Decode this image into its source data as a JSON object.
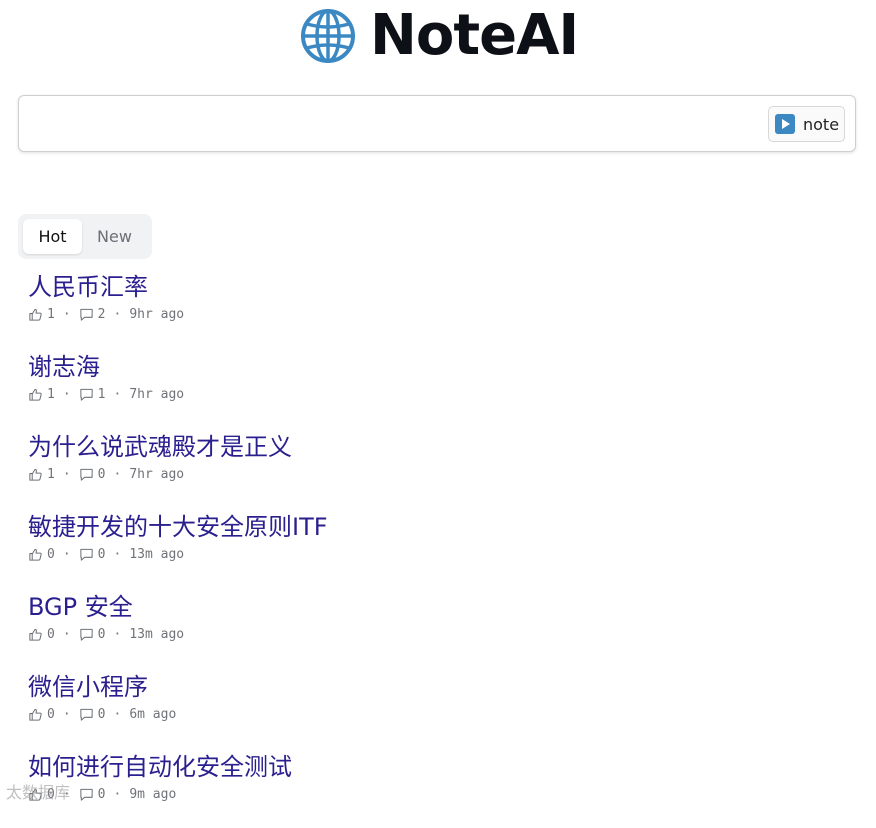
{
  "app": {
    "title": "NoteAI",
    "logo_icon": "globe-icon"
  },
  "prompt": {
    "value": "",
    "placeholder": "",
    "button_label": "note",
    "button_icon": "play-icon"
  },
  "tabs": [
    {
      "label": "Hot",
      "active": true
    },
    {
      "label": "New",
      "active": false
    }
  ],
  "posts": [
    {
      "title": "人民币汇率",
      "likes": "1",
      "comments": "2",
      "time": "9hr ago"
    },
    {
      "title": "谢志海",
      "likes": "1",
      "comments": "1",
      "time": "7hr ago"
    },
    {
      "title": "为什么说武魂殿才是正义",
      "likes": "1",
      "comments": "0",
      "time": "7hr ago"
    },
    {
      "title": "敏捷开发的十大安全原则ITF",
      "likes": "0",
      "comments": "0",
      "time": "13m ago"
    },
    {
      "title": "BGP 安全",
      "likes": "0",
      "comments": "0",
      "time": "13m ago"
    },
    {
      "title": "微信小程序",
      "likes": "0",
      "comments": "0",
      "time": "6m ago"
    },
    {
      "title": "如何进行自动化安全测试",
      "likes": "0",
      "comments": "0",
      "time": "9m ago"
    }
  ],
  "colors": {
    "title_link": "#2a1f8f",
    "meta_text": "#6f7378",
    "button_icon": "#3b88c3"
  },
  "watermark": "太数据库"
}
